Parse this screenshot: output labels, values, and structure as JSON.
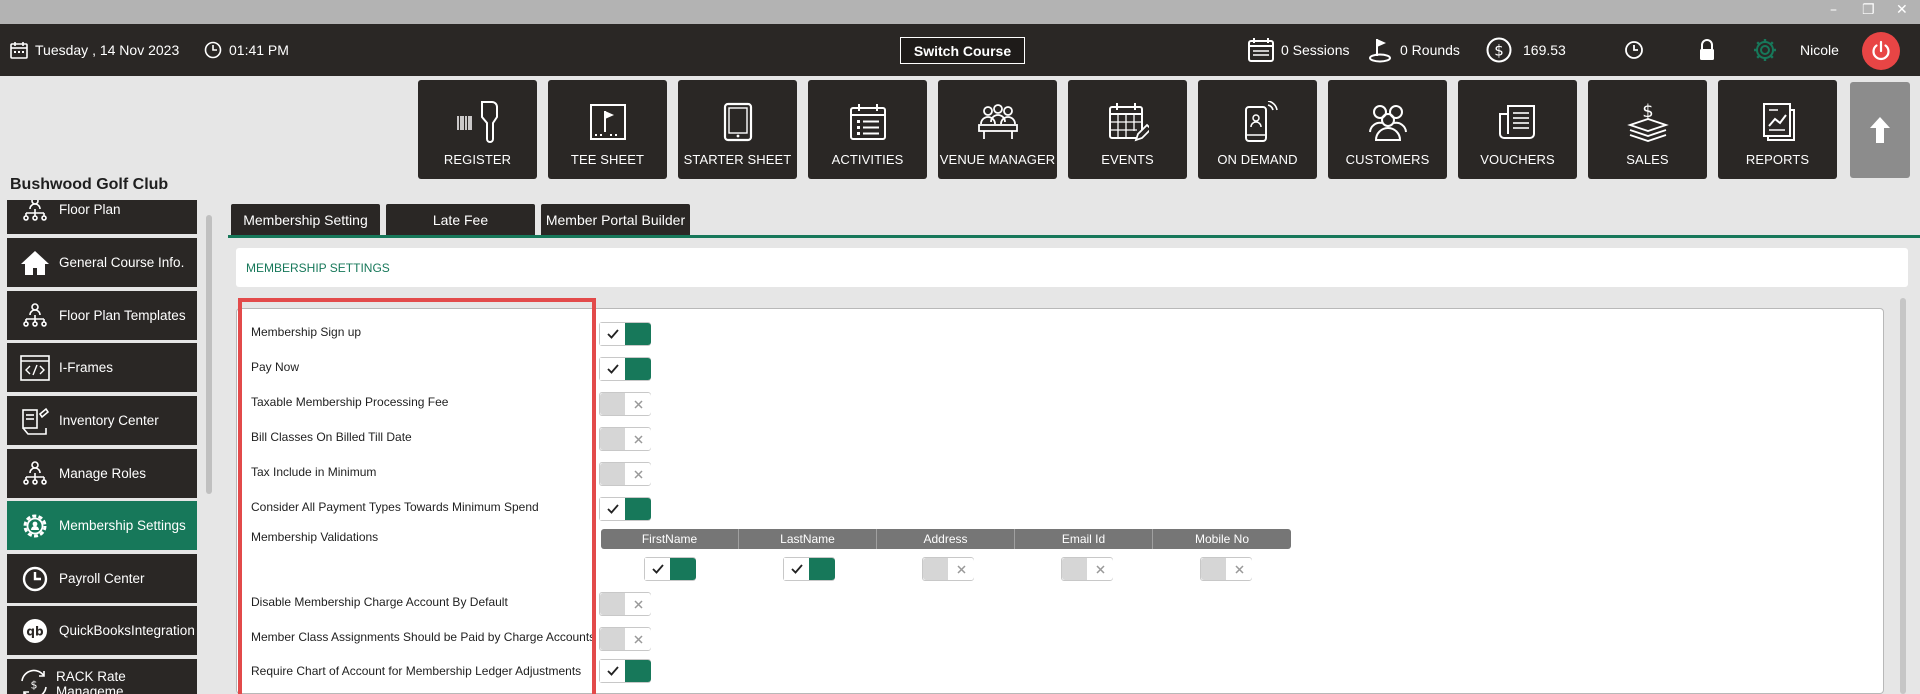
{
  "header": {
    "date": "Tuesday ,  14 Nov 2023",
    "time": "01:41 PM",
    "switch_course": "Switch Course",
    "sessions": "0 Sessions",
    "rounds": "0 Rounds",
    "balance": "169.53",
    "user": "Nicole"
  },
  "nav_tiles": [
    {
      "label": "REGISTER",
      "icon": "barcode-scanner-icon"
    },
    {
      "label": "TEE SHEET",
      "icon": "flag-board-icon"
    },
    {
      "label": "STARTER SHEET",
      "icon": "tablet-icon"
    },
    {
      "label": "ACTIVITIES",
      "icon": "calendar-list-icon"
    },
    {
      "label": "VENUE MANAGER",
      "icon": "meeting-table-icon"
    },
    {
      "label": "EVENTS",
      "icon": "calendar-edit-icon"
    },
    {
      "label": "ON DEMAND",
      "icon": "mobile-signal-icon"
    },
    {
      "label": "CUSTOMERS",
      "icon": "people-group-icon"
    },
    {
      "label": "VOUCHERS",
      "icon": "voucher-icon"
    },
    {
      "label": "SALES",
      "icon": "dollar-stack-icon"
    },
    {
      "label": "REPORTS",
      "icon": "report-chart-icon"
    }
  ],
  "club_name": "Bushwood Golf Club",
  "sidebar": {
    "items": [
      {
        "label": "Floor Plan",
        "icon": "org-chart-icon"
      },
      {
        "label": "General Course Info.",
        "icon": "home-icon"
      },
      {
        "label": "Floor Plan Templates",
        "icon": "org-chart-icon"
      },
      {
        "label": "I-Frames",
        "icon": "code-frame-icon"
      },
      {
        "label": "Inventory Center",
        "icon": "inventory-icon"
      },
      {
        "label": "Manage Roles",
        "icon": "org-chart-icon"
      },
      {
        "label": "Membership Settings",
        "icon": "gear-icon",
        "active": true
      },
      {
        "label": "Payroll Center",
        "icon": "clock-icon"
      },
      {
        "label": "QuickBooksIntegration",
        "icon": "quickbooks-icon"
      },
      {
        "label": "RACK Rate Manageme...",
        "icon": "rate-icon"
      }
    ]
  },
  "tabs": [
    "Membership Setting",
    "Late Fee",
    "Member Portal Builder"
  ],
  "section_title": "MEMBERSHIP SETTINGS",
  "settings": [
    {
      "label": "Membership Sign up",
      "on": true
    },
    {
      "label": "Pay Now",
      "on": true
    },
    {
      "label": "Taxable Membership Processing Fee",
      "on": false
    },
    {
      "label": "Bill Classes On Billed Till Date",
      "on": false
    },
    {
      "label": "Tax Include in Minimum",
      "on": false
    },
    {
      "label": "Consider All Payment Types Towards Minimum Spend",
      "on": true
    },
    {
      "label": "Membership Validations"
    },
    {
      "label": "Disable Membership Charge Account By Default",
      "on": false
    },
    {
      "label": "Member Class Assignments Should be Paid by Charge Accounts",
      "on": false
    },
    {
      "label": "Require Chart of Account for Membership Ledger Adjustments",
      "on": true
    }
  ],
  "validations": {
    "columns": [
      "FirstName",
      "LastName",
      "Address",
      "Email Id",
      "Mobile No"
    ],
    "values": [
      true,
      true,
      false,
      false,
      false
    ]
  },
  "colors": {
    "accent": "#17785a",
    "dark": "#2a2725",
    "highlight": "#e24a4a"
  }
}
